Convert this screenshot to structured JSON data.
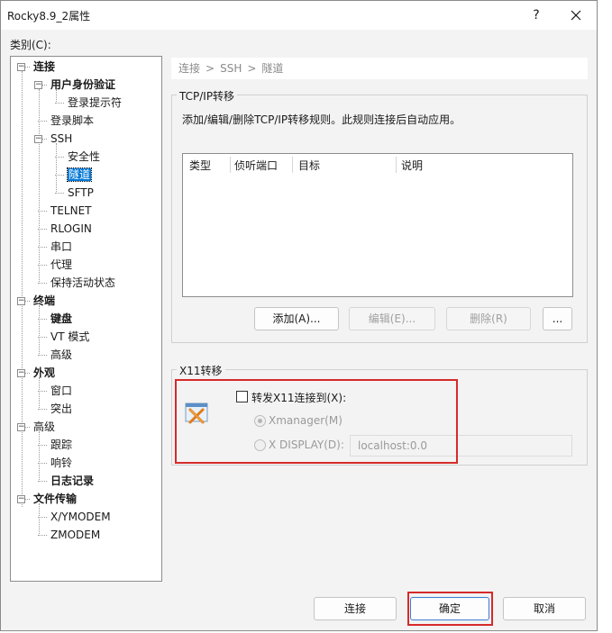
{
  "window": {
    "title": "Rocky8.9_2属性",
    "help": "?",
    "close": "✕"
  },
  "category_label": "类别(C):",
  "tree": {
    "items": [
      {
        "label": "连接",
        "bold": true,
        "toggle": "−"
      },
      {
        "label": "用户身份验证",
        "bold": true,
        "toggle": "−"
      },
      {
        "label": "登录提示符",
        "bold": false
      },
      {
        "label": "登录脚本",
        "bold": false
      },
      {
        "label": "SSH",
        "bold": false,
        "toggle": "−"
      },
      {
        "label": "安全性",
        "bold": false
      },
      {
        "label": "隧道",
        "bold": false,
        "selected": true
      },
      {
        "label": "SFTP",
        "bold": false
      },
      {
        "label": "TELNET",
        "bold": false
      },
      {
        "label": "RLOGIN",
        "bold": false
      },
      {
        "label": "串口",
        "bold": false
      },
      {
        "label": "代理",
        "bold": false
      },
      {
        "label": "保持活动状态",
        "bold": false
      },
      {
        "label": "终端",
        "bold": true,
        "toggle": "−"
      },
      {
        "label": "键盘",
        "bold": true
      },
      {
        "label": "VT 模式",
        "bold": false
      },
      {
        "label": "高级",
        "bold": false
      },
      {
        "label": "外观",
        "bold": true,
        "toggle": "−"
      },
      {
        "label": "窗口",
        "bold": false
      },
      {
        "label": "突出",
        "bold": false
      },
      {
        "label": "高级",
        "bold": false,
        "toggle": "−"
      },
      {
        "label": "跟踪",
        "bold": false
      },
      {
        "label": "响铃",
        "bold": false
      },
      {
        "label": "日志记录",
        "bold": true
      },
      {
        "label": "文件传输",
        "bold": true,
        "toggle": "−"
      },
      {
        "label": "X/YMODEM",
        "bold": false
      },
      {
        "label": "ZMODEM",
        "bold": false
      }
    ]
  },
  "breadcrumb": {
    "parts": [
      "连接",
      "SSH",
      "隧道"
    ],
    "separator": ">"
  },
  "tcpip": {
    "title": "TCP/IP转移",
    "description": "添加/编辑/删除TCP/IP转移规则。此规则连接后自动应用。",
    "columns": [
      "类型",
      "侦听端口",
      "目标",
      "说明"
    ],
    "buttons": {
      "add": "添加(A)...",
      "edit": "编辑(E)...",
      "delete": "删除(R)",
      "more": "..."
    }
  },
  "x11": {
    "title": "X11转移",
    "forward_label": "转发X11连接到(X):",
    "xmanager_label": "Xmanager(M)",
    "xdisplay_label": "X DISPLAY(D):",
    "xdisplay_value": "localhost:0.0"
  },
  "footer": {
    "connect": "连接",
    "ok": "确定",
    "cancel": "取消"
  },
  "colors": {
    "selection": "#0078d7",
    "highlight_box": "#d62a2a"
  }
}
